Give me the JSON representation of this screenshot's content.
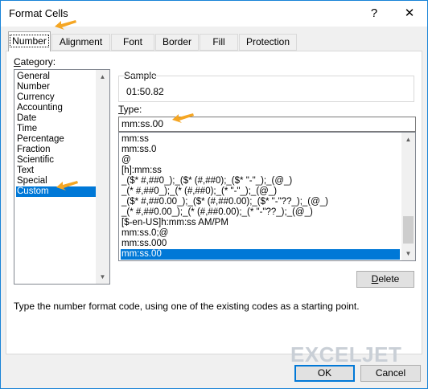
{
  "window": {
    "title": "Format Cells",
    "help": "?",
    "close": "✕"
  },
  "tabs": [
    "Number",
    "Alignment",
    "Font",
    "Border",
    "Fill",
    "Protection"
  ],
  "category": {
    "label_u": "C",
    "label_rest": "ategory:",
    "items": [
      "General",
      "Number",
      "Currency",
      "Accounting",
      "Date",
      "Time",
      "Percentage",
      "Fraction",
      "Scientific",
      "Text",
      "Special",
      "Custom"
    ],
    "selected": "Custom"
  },
  "sample": {
    "label": "Sample",
    "value": "01:50.82"
  },
  "type": {
    "label_u": "T",
    "label_rest": "ype:",
    "value": "mm:ss.00"
  },
  "formats": {
    "items": [
      "mm:ss",
      "mm:ss.0",
      "@",
      "[h]:mm:ss",
      "_($* #,##0_);_($* (#,##0);_($* \"-\"_);_(@_)",
      "_(* #,##0_);_(* (#,##0);_(* \"-\"_);_(@_)",
      "_($* #,##0.00_);_($* (#,##0.00);_($* \"-\"??_);_(@_)",
      "_(* #,##0.00_);_(* (#,##0.00);_(* \"-\"??_);_(@_)",
      "[$-en-US]h:mm:ss AM/PM",
      "mm:ss.0;@",
      "mm:ss.000",
      "mm:ss.00"
    ],
    "selected": "mm:ss.00"
  },
  "buttons": {
    "delete_u": "D",
    "delete_rest": "elete",
    "ok": "OK",
    "cancel": "Cancel"
  },
  "description": "Type the number format code, using one of the existing codes as a starting point.",
  "watermark": "EXCELJET",
  "colors": {
    "accent": "#0078d7",
    "arrow": "#f5a623",
    "window_bg": "#f0f0f0"
  }
}
